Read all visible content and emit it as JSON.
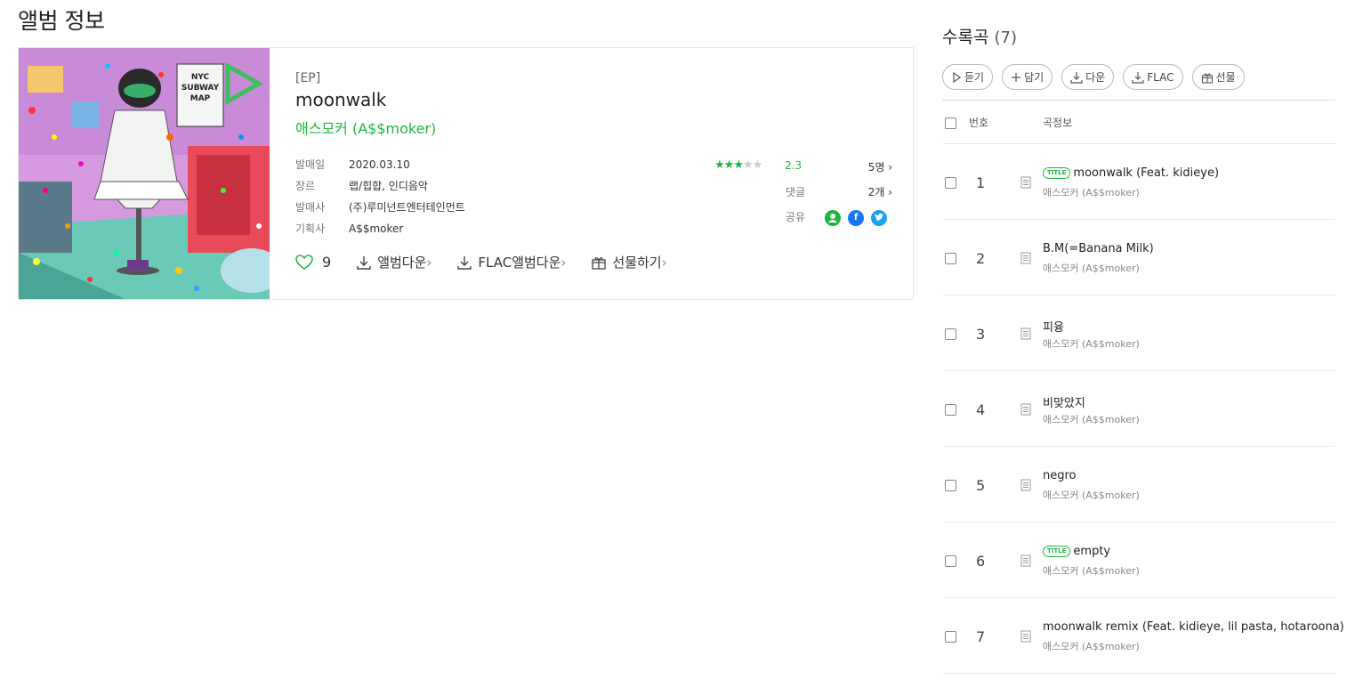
{
  "page": {
    "title": "앨범 정보"
  },
  "album": {
    "type": "[EP]",
    "title": "moonwalk",
    "artist": "애스모커 (A$$moker)",
    "meta": [
      {
        "label": "발매일",
        "value": "2020.03.10"
      },
      {
        "label": "장르",
        "value": "랩/힙합, 인디음악"
      },
      {
        "label": "발매사",
        "value": "(주)루미넌트엔터테인먼트"
      },
      {
        "label": "기획사",
        "value": "A$$moker"
      }
    ],
    "rating": {
      "stars": 2.3,
      "score": "2.3",
      "count": "5명"
    },
    "comments": {
      "label": "댓글",
      "count": "2개"
    },
    "share": {
      "label": "공유",
      "icons": [
        "melon-friend-icon",
        "facebook-icon",
        "twitter-icon"
      ]
    },
    "likes": "9",
    "actions": {
      "album_download": "앨범다운",
      "flac_download": "FLAC앨범다운",
      "gift": "선물하기"
    },
    "cover_art_text": "NYC SUBWAY MAP"
  },
  "tracklist": {
    "heading": "수록곡",
    "count": "(7)",
    "buttons": {
      "listen": "듣기",
      "add": "담기",
      "download": "다운",
      "flac": "FLAC",
      "gift": "선물"
    },
    "columns": {
      "number": "번호",
      "info": "곡정보"
    },
    "title_badge": "TITLE",
    "tracks": [
      {
        "no": "1",
        "name": "moonwalk (Feat. kidieye)",
        "artist": "애스모커 (A$$moker)",
        "title": true
      },
      {
        "no": "2",
        "name": "B.M(=Banana Milk)",
        "artist": "애스모커 (A$$moker)",
        "title": false
      },
      {
        "no": "3",
        "name": "피융",
        "artist": "애스모커 (A$$moker)",
        "title": false
      },
      {
        "no": "4",
        "name": "비맞았지",
        "artist": "애스모커 (A$$moker)",
        "title": false
      },
      {
        "no": "5",
        "name": "negro",
        "artist": "애스모커 (A$$moker)",
        "title": false
      },
      {
        "no": "6",
        "name": "empty",
        "artist": "애스모커 (A$$moker)",
        "title": true
      },
      {
        "no": "7",
        "name": "moonwalk remix (Feat. kidieye, lil pasta, hotaroona)",
        "artist": "애스모커 (A$$moker)",
        "title": false
      }
    ]
  },
  "colors": {
    "accent": "#1eb73d",
    "facebook": "#1877f2",
    "twitter": "#1da1f2"
  }
}
